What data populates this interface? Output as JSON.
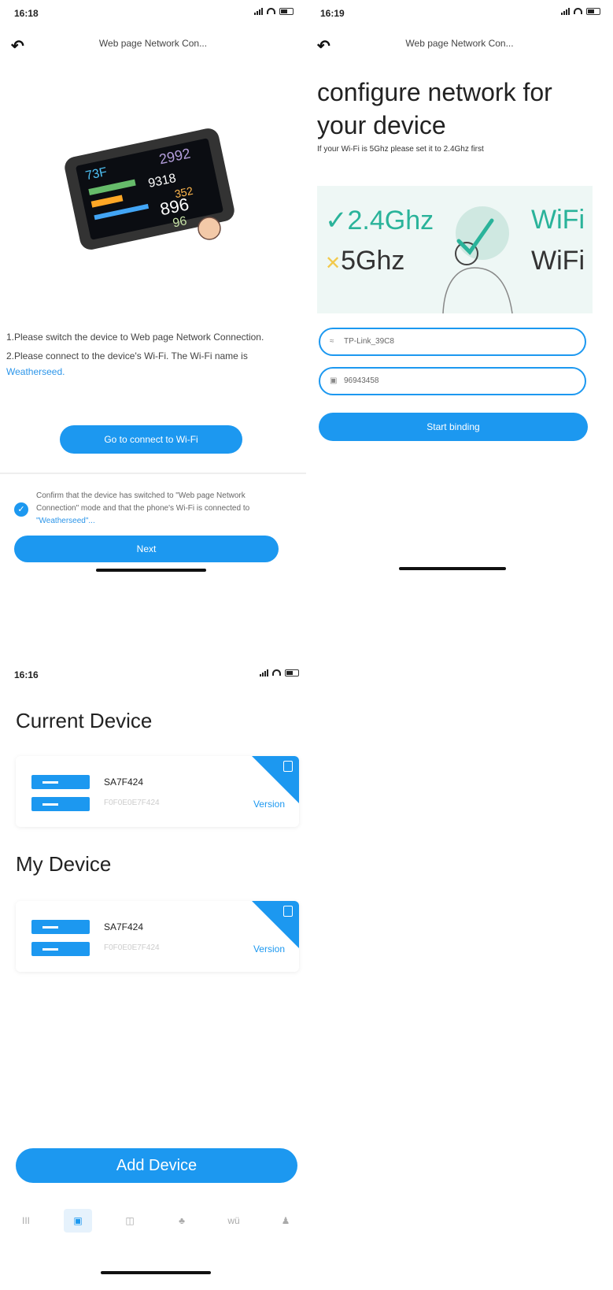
{
  "screen1": {
    "status_time": "16:18",
    "nav_title": "Web page Network Con...",
    "device_readouts": [
      "73F",
      "2992",
      "9318",
      "352",
      "896",
      "96"
    ],
    "instruction1": "1.Please switch the device to Web page Network Connection.",
    "instruction2_prefix": "2.Please connect to the device's Wi-Fi. The Wi-Fi name is ",
    "instruction2_link": "Weatherseed.",
    "connect_button": "Go to connect to Wi-Fi",
    "confirm_text_prefix": "Confirm that the device has switched to \"Web page Network Connection\" mode and that the phone's Wi-Fi is connected to ",
    "confirm_text_link": "\"Weatherseed\"...",
    "next_button": "Next"
  },
  "screen2": {
    "status_time": "16:19",
    "nav_title": "Web page Network Con...",
    "title": "configure network for your device",
    "note": "If your Wi-Fi is 5Ghz please set it to 2.4Ghz first",
    "banner_ok_band": "2.4Ghz",
    "banner_ok_wifi": "WiFi",
    "banner_bad_band": "5Ghz",
    "banner_bad_wifi": "WiFi",
    "ssid_value": "TP-Link_39C8",
    "password_value": "96943458",
    "start_button": "Start binding"
  },
  "screen3": {
    "status_time": "16:16",
    "current_title": "Current Device",
    "my_title": "My Device",
    "current_device": {
      "name": "SA7F424",
      "sub": "F0F0E0E7F424",
      "version": "Version"
    },
    "my_device": {
      "name": "SA7F424",
      "sub": "F0F0E0E7F424",
      "version": "Version"
    },
    "add_button": "Add Device",
    "tabs": [
      "III",
      "▣",
      "◫",
      "♣",
      "wü",
      "♟"
    ]
  },
  "colors": {
    "accent": "#1c98f0",
    "ok": "#2ab39a",
    "warn": "#f2c94c"
  }
}
